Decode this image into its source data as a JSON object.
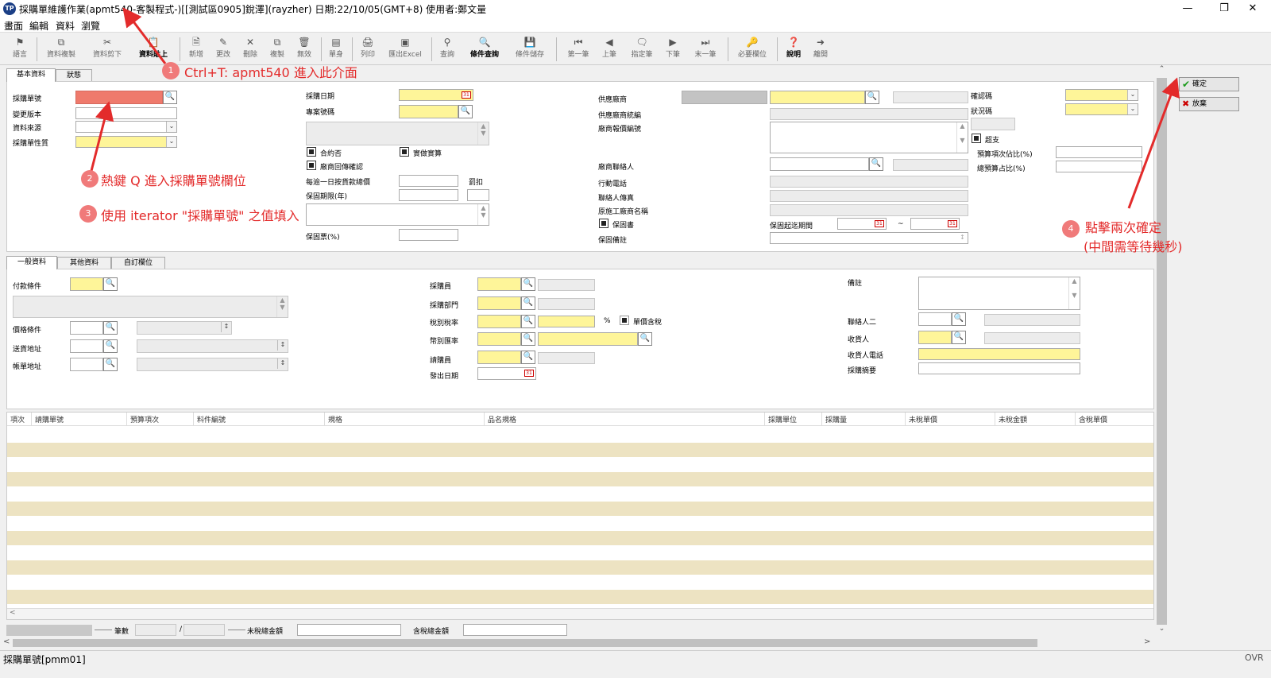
{
  "window": {
    "title": "採購單維護作業(apmt540-客製程式-)[[測試區0905]銳澤](rayzher)  日期:22/10/05(GMT+8)  使用者:鄭文量",
    "app_icon": "TP"
  },
  "menu": [
    "畫面",
    "編輯",
    "資料",
    "瀏覽"
  ],
  "toolbar": [
    {
      "icon": "flag-icon",
      "label": "語言"
    },
    {
      "icon": "copy-icon",
      "label": "資料複製"
    },
    {
      "icon": "cut-icon",
      "label": "資料剪下"
    },
    {
      "icon": "paste-icon",
      "label": "資料貼上"
    },
    {
      "icon": "new-icon",
      "label": "新增"
    },
    {
      "icon": "edit-icon",
      "label": "更改"
    },
    {
      "icon": "delete-icon",
      "label": "刪除"
    },
    {
      "icon": "duplicate-icon",
      "label": "複製"
    },
    {
      "icon": "void-icon",
      "label": "無效"
    },
    {
      "icon": "single-icon",
      "label": "單身"
    },
    {
      "icon": "print-icon",
      "label": "列印"
    },
    {
      "icon": "excel-icon",
      "label": "匯出Excel"
    },
    {
      "icon": "binoculars-icon",
      "label": "查詢"
    },
    {
      "icon": "query-cond-icon",
      "label": "條件查詢"
    },
    {
      "icon": "save-cond-icon",
      "label": "條件儲存"
    },
    {
      "icon": "first-icon",
      "label": "第一筆"
    },
    {
      "icon": "prev-icon",
      "label": "上筆"
    },
    {
      "icon": "goto-icon",
      "label": "指定筆"
    },
    {
      "icon": "next-icon",
      "label": "下筆"
    },
    {
      "icon": "last-icon",
      "label": "末一筆"
    },
    {
      "icon": "key-icon",
      "label": "必要欄位"
    },
    {
      "icon": "help-icon",
      "label": "說明"
    },
    {
      "icon": "exit-icon",
      "label": "離開"
    }
  ],
  "top_tabs": [
    "基本資料",
    "狀態"
  ],
  "basic": {
    "po_no": "採購單號",
    "version": "變更版本",
    "source": "資料來源",
    "po_type": "採購單性質",
    "po_date": "採購日期",
    "project_no": "專案號碼",
    "contract": "合約否",
    "actual_budget": "實做實算",
    "vendor_confirm": "廠商回傳確認",
    "daily_penalty": "每逾一日按貨款總價",
    "penalty": "罰扣",
    "warranty_years": "保固期限(年)",
    "warranty_ticket": "保固票(%)",
    "vendor": "供應廠商",
    "vendor_id": "供應廠商統編",
    "vendor_quote": "廠商報價編號",
    "vendor_contact": "廠商聯絡人",
    "mobile": "行動電話",
    "contact_fax": "聯絡人傳真",
    "orig_vendor": "原施工廠商名稱",
    "warranty_doc": "保固書",
    "warranty_period": "保固起迄期間",
    "tilde": "~",
    "warranty_note": "保固備註",
    "confirm_code": "確認碼",
    "status_code": "狀況碼",
    "overspend": "超支",
    "budget_ratio": "預算項次佔比(%)",
    "total_budget_ratio": "總預算占比(%)"
  },
  "right_buttons": {
    "ok": "確定",
    "cancel": "放棄"
  },
  "general_tabs": [
    "一般資料",
    "其他資料",
    "自訂欄位"
  ],
  "general": {
    "payment": "付款條件",
    "price_term": "價格條件",
    "ship_addr": "送貨地址",
    "bill_addr": "帳單地址",
    "buyer": "採購員",
    "dept": "採購部門",
    "tax": "稅別稅率",
    "pct": "%",
    "tax_incl": "單價含稅",
    "currency": "幣別匯率",
    "requester": "請購員",
    "issue_date": "發出日期",
    "remark": "備註",
    "contact2": "聯絡人二",
    "receiver": "收貨人",
    "receiver_phone": "收貨人電話",
    "summary": "採購摘要"
  },
  "grid_columns": [
    "項次",
    "請購單號",
    "預算項次",
    "料件編號",
    "規格",
    "品名規格",
    "採購單位",
    "採購量",
    "未稅單價",
    "未稅金額",
    "含稅單價"
  ],
  "footer": {
    "count": "筆數",
    "slash": "/",
    "untaxed_total": "未稅總金額",
    "taxed_total": "含稅總金額"
  },
  "status": {
    "field": "採購單號[pmm01]",
    "mode": "OVR"
  },
  "annotations": {
    "a1": {
      "n": "1",
      "text": "Ctrl+T: apmt540 進入此介面"
    },
    "a2": {
      "n": "2",
      "text": "熱鍵 Q 進入採購單號欄位"
    },
    "a3": {
      "n": "3",
      "text": "使用 iterator \"採購單號\" 之值填入"
    },
    "a4": {
      "n": "4",
      "text": "點擊兩次確定",
      "text2": "(中間需等待幾秒)"
    }
  },
  "colors": {
    "required": "#fef599",
    "focused": "#ef7a6c",
    "annotation": "#e32b2b",
    "stripe": "#ede3c2"
  }
}
